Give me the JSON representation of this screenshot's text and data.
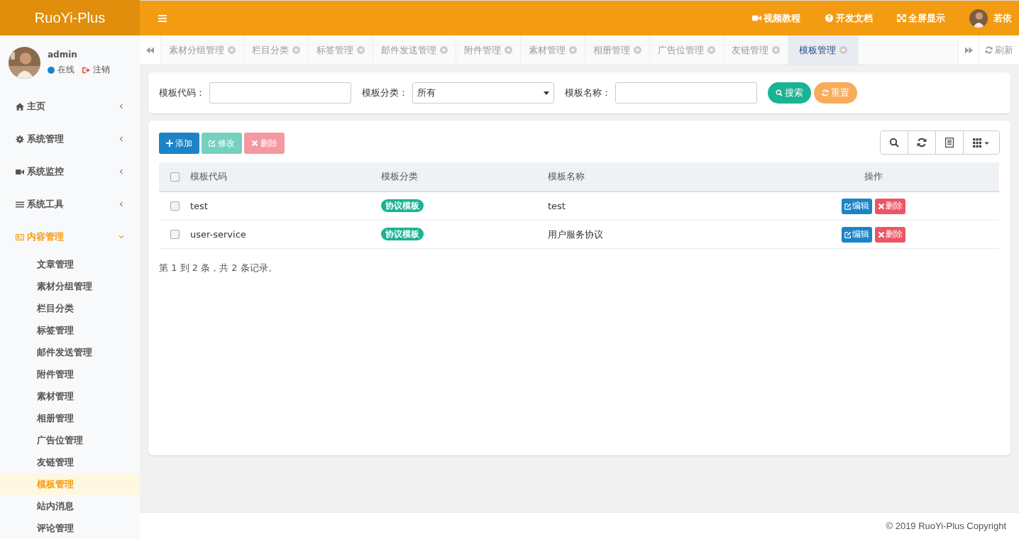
{
  "brand": "RuoYi-Plus",
  "header": {
    "links": [
      {
        "label": "视频教程"
      },
      {
        "label": "开发文档"
      },
      {
        "label": "全屏显示"
      }
    ],
    "user": "若依"
  },
  "user_panel": {
    "name": "admin",
    "status": "在线",
    "logout": "注销"
  },
  "sidebar": {
    "items": [
      {
        "label": "主页",
        "selected": false,
        "expanded": false
      },
      {
        "label": "系统管理",
        "selected": false,
        "expanded": false
      },
      {
        "label": "系统监控",
        "selected": false,
        "expanded": false
      },
      {
        "label": "系统工具",
        "selected": false,
        "expanded": false
      },
      {
        "label": "内容管理",
        "selected": true,
        "expanded": true,
        "children": [
          {
            "label": "文章管理",
            "selected": false
          },
          {
            "label": "素材分组管理",
            "selected": false
          },
          {
            "label": "栏目分类",
            "selected": false
          },
          {
            "label": "标签管理",
            "selected": false
          },
          {
            "label": "邮件发送管理",
            "selected": false
          },
          {
            "label": "附件管理",
            "selected": false
          },
          {
            "label": "素材管理",
            "selected": false
          },
          {
            "label": "相册管理",
            "selected": false
          },
          {
            "label": "广告位管理",
            "selected": false
          },
          {
            "label": "友链管理",
            "selected": false
          },
          {
            "label": "模板管理",
            "selected": true
          },
          {
            "label": "站内消息",
            "selected": false
          },
          {
            "label": "评论管理",
            "selected": false
          }
        ]
      }
    ]
  },
  "tabs": [
    {
      "label": "素材分组管理",
      "selected": false
    },
    {
      "label": "栏目分类",
      "selected": false
    },
    {
      "label": "标签管理",
      "selected": false
    },
    {
      "label": "邮件发送管理",
      "selected": false
    },
    {
      "label": "附件管理",
      "selected": false
    },
    {
      "label": "素材管理",
      "selected": false
    },
    {
      "label": "相册管理",
      "selected": false
    },
    {
      "label": "广告位管理",
      "selected": false
    },
    {
      "label": "友链管理",
      "selected": false
    },
    {
      "label": "模板管理",
      "selected": true
    }
  ],
  "refresh": "刷新",
  "search_form": {
    "fields": [
      {
        "kind": "text",
        "label": "模板代码："
      },
      {
        "kind": "select",
        "label": "模板分类：",
        "value": "所有"
      },
      {
        "kind": "text",
        "label": "模板名称："
      }
    ],
    "buttons": [
      {
        "kind": "search",
        "label": "搜索"
      },
      {
        "kind": "reset",
        "label": "重置"
      }
    ]
  },
  "toolbar": [
    {
      "kind": "add",
      "label": "添加",
      "disabled": false
    },
    {
      "kind": "edit",
      "label": "修改",
      "disabled": true
    },
    {
      "kind": "delete",
      "label": "删除",
      "disabled": true
    }
  ],
  "table": {
    "all_checked": false,
    "columns": [
      "模板代码",
      "模板分类",
      "模板名称",
      "操作"
    ],
    "rows": [
      {
        "checked": false,
        "code": "test",
        "category": "协议模板",
        "name": "test",
        "actions": [
          "编辑",
          "删除"
        ]
      },
      {
        "checked": false,
        "code": "user-service",
        "category": "协议模板",
        "name": "用户服务协议",
        "actions": [
          "编辑",
          "删除"
        ]
      }
    ]
  },
  "pagination": "第 1 到 2 条，共 2 条记录。",
  "footer": "© 2019 RuoYi-Plus Copyright"
}
